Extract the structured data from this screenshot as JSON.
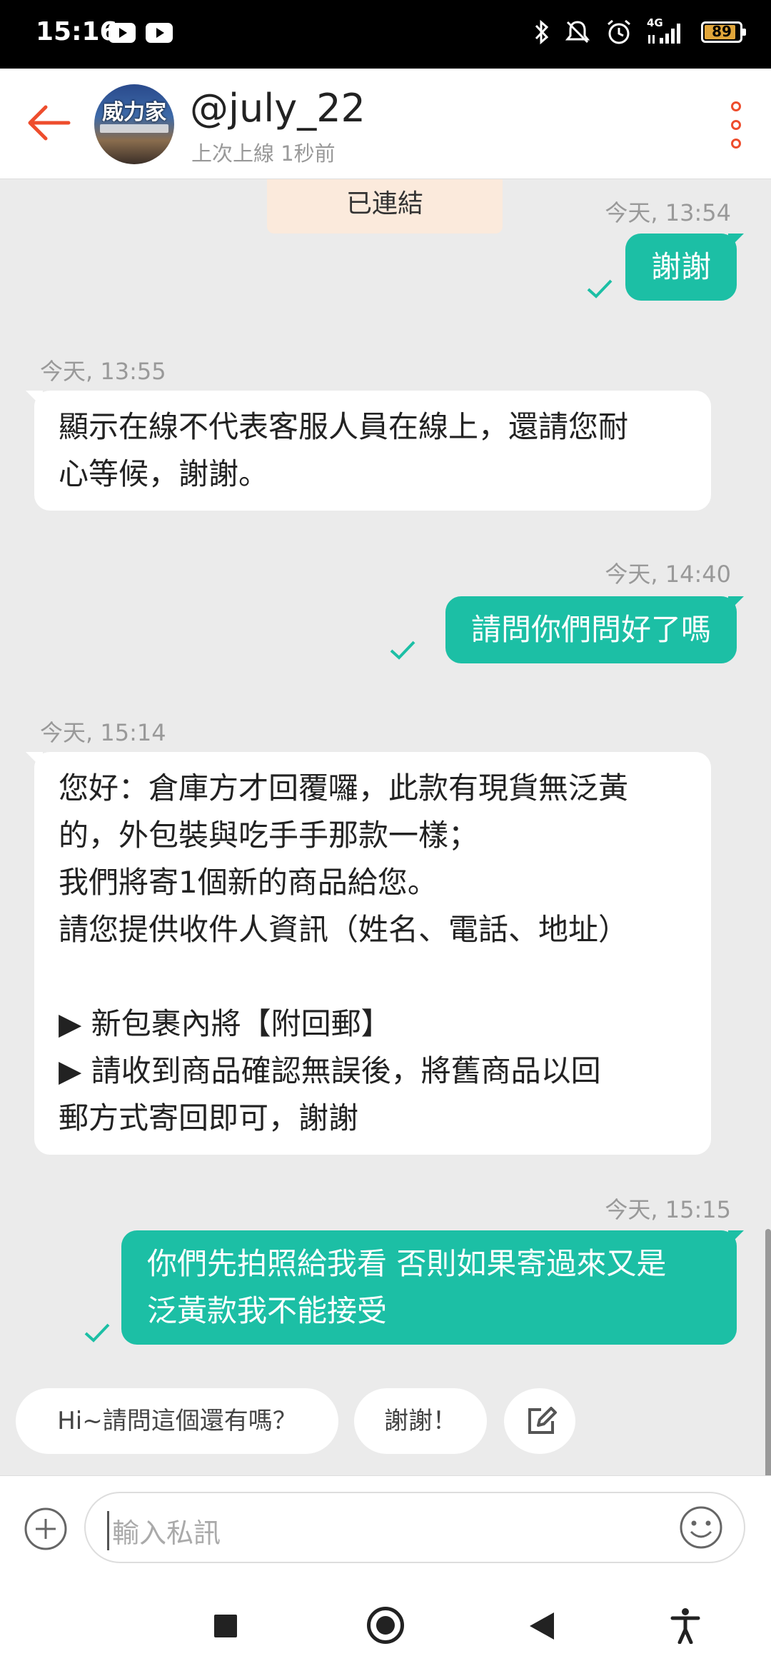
{
  "status_bar": {
    "time": "15:16",
    "network": "4G",
    "battery": "89",
    "battery_level": 0.89,
    "icons": [
      "youtube-icon",
      "youtube-icon",
      "bluetooth-icon",
      "mute-icon",
      "alarm-icon",
      "signal-icon",
      "battery-icon"
    ]
  },
  "header": {
    "avatar_text": "威力家",
    "username": "@july_22",
    "last_seen": "上次上線 1秒前",
    "colors": {
      "accent": "#ee4d2d"
    }
  },
  "chat": {
    "linked_label": "已連結",
    "messages": [
      {
        "direction": "out",
        "timestamp": "今天, 13:54",
        "text": "謝謝",
        "status": "read"
      },
      {
        "direction": "in",
        "timestamp": "今天, 13:55",
        "text": "顯示在線不代表客服人員在線上，還請您耐\n心等候，謝謝。"
      },
      {
        "direction": "out",
        "timestamp": "今天, 14:40",
        "text": "請問你們問好了嗎",
        "status": "read"
      },
      {
        "direction": "in",
        "timestamp": "今天, 15:14",
        "text": "您好：倉庫方才回覆囉，此款有現貨無泛黃\n的，外包裝與吃手手那款一樣；\n我們將寄1個新的商品給您。\n請您提供收件人資訊（姓名、電話、地址）\n\n▶ 新包裹內將【附回郵】\n▶ 請收到商品確認無誤後，將舊商品以回\n郵方式寄回即可，謝謝"
      },
      {
        "direction": "out",
        "timestamp": "今天, 15:15",
        "text": "你們先拍照給我看 否則如果寄過來又是\n泛黃款我不能接受",
        "status": "read"
      }
    ],
    "colors": {
      "outgoing": "#1cbfa5",
      "incoming": "#ffffff",
      "background": "#ebebeb"
    }
  },
  "quick_replies": [
    "Hi~請問這個還有嗎？",
    "謝謝！"
  ],
  "composer": {
    "placeholder": "輸入私訊"
  },
  "nav_bar": {
    "buttons": [
      "recents",
      "home",
      "back",
      "accessibility"
    ]
  }
}
